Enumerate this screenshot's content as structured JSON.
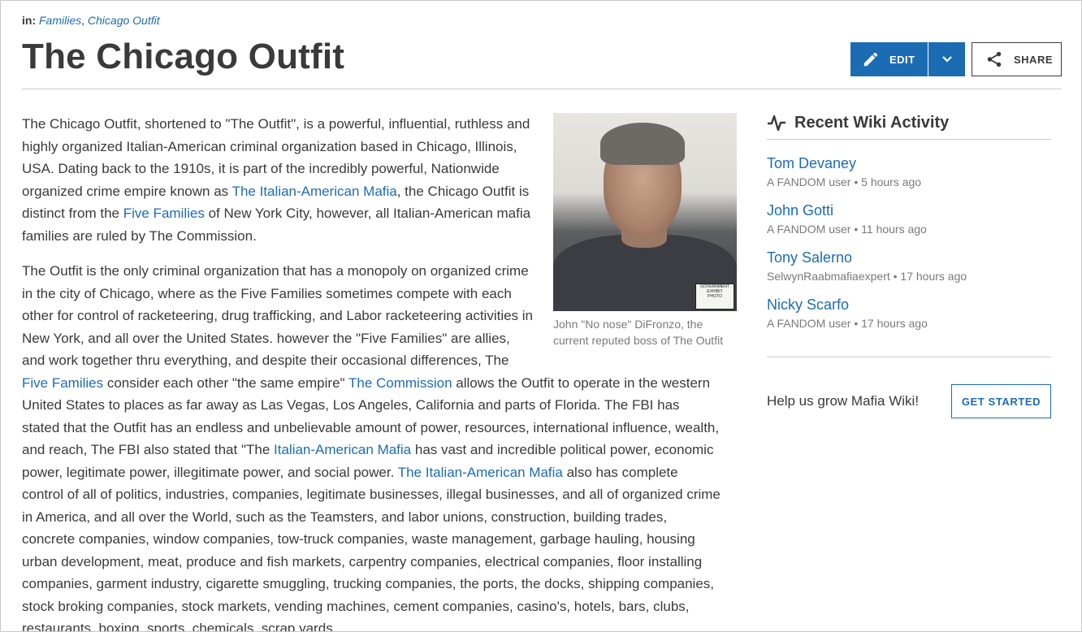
{
  "breadcrumb": {
    "prefix": "in:",
    "links": [
      "Families",
      "Chicago Outfit"
    ]
  },
  "page_title": "The Chicago Outfit",
  "toolbar": {
    "edit_label": "EDIT",
    "share_label": "SHARE"
  },
  "figure": {
    "caption": "John \"No nose\" DiFronzo, the current reputed boss of The Outfit"
  },
  "article": {
    "p1": [
      "The Chicago Outfit, shortened to \"The Outfit\", is a powerful, influential, ruthless and highly organized Italian-American criminal organization based in Chicago, Illinois, USA. Dating back to the 1910s, it is part of the incredibly powerful, Nationwide organized crime empire known as ",
      "The Italian-American Mafia",
      ", the Chicago Outfit is distinct from the ",
      "Five Families",
      " of New York City, however, all Italian-American mafia families are ruled by The Commission."
    ],
    "p2": [
      "The Outfit is the only criminal organization that has a monopoly on organized crime in the city of Chicago, where as the Five Families sometimes compete with each other for control of racketeering, drug trafficking, and Labor racketeering activities in New York, and all over the United States. however the \"Five Families\" are allies, and work together thru everything, and despite their occasional differences, The ",
      "Five Families",
      " consider each other \"the same empire\" ",
      "The Commission",
      " allows the Outfit to operate in the western United States to places as far away as Las Vegas, Los Angeles, California and parts of Florida. The FBI has stated that the Outfit has an endless and unbelievable amount of power, resources, international influence, wealth, and reach, The FBI also stated that \"The ",
      "Italian-American Mafia",
      " has vast and incredible political power, economic power, legitimate power, illegitimate power, and social power. ",
      "The Italian-American Mafia",
      " also has complete control of all of politics, industries, companies, legitimate businesses, illegal businesses, and all of organized crime in America, and all over the World, such as the Teamsters, and labor unions, construction, building trades, concrete companies, window companies, tow-truck companies, waste management, garbage hauling, housing urban development, meat, produce and fish markets, carpentry companies, electrical companies, floor installing companies, garment industry, cigarette smuggling, trucking companies, the ports, the docks, shipping companies, stock broking companies, stock markets, vending machines, cement companies, casino's, hotels, bars, clubs, restaurants, boxing, sports, chemicals, scrap yards,"
    ]
  },
  "rail": {
    "title": "Recent Wiki Activity",
    "items": [
      {
        "title": "Tom Devaney",
        "meta": "A FANDOM user • 5 hours ago"
      },
      {
        "title": "John Gotti",
        "meta": "A FANDOM user • 11 hours ago"
      },
      {
        "title": "Tony Salerno",
        "meta": "SelwynRaabmafiaexpert • 17 hours ago"
      },
      {
        "title": "Nicky Scarfo",
        "meta": "A FANDOM user • 17 hours ago"
      }
    ],
    "grow_text": "Help us grow Mafia Wiki!",
    "get_started_label": "GET STARTED"
  },
  "colors": {
    "link": "#1c6cb4",
    "text": "#3a3a3a",
    "muted": "#7a7a7a"
  }
}
